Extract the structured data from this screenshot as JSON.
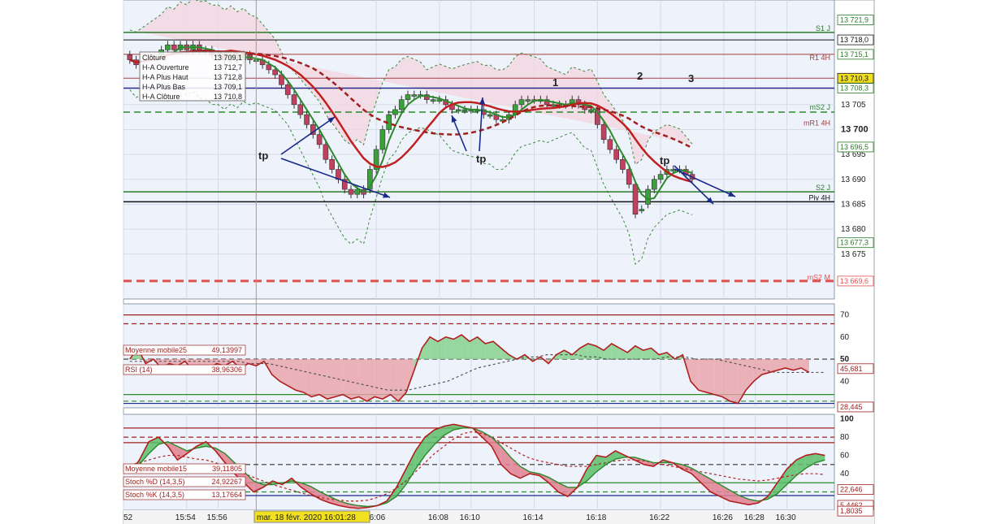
{
  "chart_data": [
    {
      "type": "candlestick",
      "panel": "price",
      "ylim": [
        13666,
        13726
      ],
      "y_ticks": [
        13675,
        13680,
        13685,
        13690,
        13695,
        13700,
        13705
      ],
      "y_tick_labels": [
        "13 675",
        "13 680",
        "13 685",
        "13 690",
        "13 695",
        "13 700",
        "13 705"
      ],
      "x_tick_labels": [
        "52",
        "15:54",
        "15:56",
        "16:06",
        "16:08",
        "16:10",
        "16:14",
        "16:18",
        "16:22",
        "16:26",
        "16:28",
        "16:30"
      ],
      "x_tick_positions": [
        0,
        2,
        3,
        8,
        10,
        11,
        13,
        15,
        17,
        19,
        20,
        21
      ],
      "x_range": [
        0,
        22.5
      ],
      "legend": [
        {
          "label": "Clôture",
          "value": "13 709,1"
        },
        {
          "label": "H-A Ouverture",
          "value": "13 712,7"
        },
        {
          "label": "H-A Plus Haut",
          "value": "13 712,8"
        },
        {
          "label": "H-A Plus Bas",
          "value": "13 709,1"
        },
        {
          "label": "H-A Clôture",
          "value": "13 710,8"
        }
      ],
      "candles_t": [
        0.2,
        0.4,
        1.2,
        1.4,
        1.6,
        1.8,
        2.0,
        2.2,
        2.4,
        2.6,
        2.8,
        3.0,
        3.2,
        3.4,
        3.6,
        3.8,
        4.0,
        4.2,
        4.4,
        4.6,
        4.8,
        5.0,
        5.2,
        5.4,
        5.6,
        5.8,
        6.0,
        6.2,
        6.4,
        6.6,
        6.8,
        7.0,
        7.2,
        7.4,
        7.6,
        7.8,
        8.0,
        8.2,
        8.4,
        8.6,
        8.8,
        9.0,
        9.2,
        9.4,
        9.6,
        9.8,
        10.0,
        10.2,
        10.4,
        10.6,
        10.8,
        11.0,
        11.2,
        11.4,
        11.6,
        11.8,
        12.0,
        12.2,
        12.4,
        12.6,
        12.8,
        13.0,
        13.2,
        13.4,
        13.6,
        13.8,
        14.0,
        14.2,
        14.4,
        14.6,
        14.8,
        15.0,
        15.2,
        15.4,
        15.6,
        15.8,
        16.0,
        16.2,
        16.4,
        16.6,
        16.8,
        17.0,
        17.2,
        17.4,
        17.6,
        17.8,
        18.0,
        18.2,
        18.4,
        18.6,
        18.8,
        19.0,
        19.2,
        19.4,
        19.6,
        19.8,
        20.0,
        20.2,
        20.4,
        20.6,
        20.8,
        21.0,
        21.2,
        21.4,
        21.6,
        21.8,
        22.0,
        22.2
      ],
      "candles_c": [
        13714,
        13713,
        13716,
        13717,
        13716,
        13717,
        13716,
        13717,
        13716,
        13716,
        13715,
        13715,
        13714,
        13715,
        13714,
        13715,
        13714,
        13714,
        13713,
        13712,
        13711,
        13709,
        13707,
        13705,
        13703,
        13701,
        13699,
        13697,
        13694,
        13692,
        13690,
        13688,
        13687,
        13688,
        13687,
        13692,
        13696,
        13700,
        13703,
        13704,
        13706,
        13707,
        13707,
        13707,
        13706,
        13706,
        13706,
        13705,
        13704,
        13704,
        13704,
        13704,
        13704,
        13703,
        13703,
        13702,
        13702,
        13703,
        13705,
        13706,
        13706,
        13706,
        13706,
        13705,
        13705,
        13705,
        13705,
        13706,
        13705,
        13704,
        13704,
        13701,
        13698,
        13696,
        13694,
        13692,
        13689,
        13683,
        13684,
        13688,
        13690,
        13691,
        13692,
        13692,
        13692,
        13691,
        13690
      ],
      "candles_o": [
        13715,
        13714,
        13715,
        13716,
        13717,
        13716,
        13717,
        13716,
        13717,
        13716,
        13716,
        13715,
        13715,
        13714,
        13715,
        13714,
        13715,
        13714,
        13714,
        13713,
        13712,
        13711,
        13709,
        13707,
        13705,
        13703,
        13701,
        13699,
        13697,
        13694,
        13692,
        13690,
        13688,
        13687,
        13688,
        13688,
        13692,
        13696,
        13700,
        13703,
        13704,
        13706,
        13707,
        13707,
        13707,
        13706,
        13706,
        13706,
        13705,
        13704,
        13704,
        13704,
        13704,
        13704,
        13703,
        13703,
        13702,
        13702,
        13703,
        13705,
        13706,
        13706,
        13706,
        13706,
        13705,
        13705,
        13705,
        13705,
        13706,
        13705,
        13704,
        13704,
        13701,
        13698,
        13696,
        13694,
        13692,
        13689,
        13684,
        13685,
        13688,
        13690,
        13691,
        13692,
        13692,
        13692,
        13691
      ],
      "support_resistance_labels": [
        "S1 J",
        "R1 4H",
        "mS2 J",
        "mR1 4H",
        "S2 J",
        "Piv 4H",
        "mS2 M"
      ],
      "price_labels": [
        "13 721,9",
        "13 718,0",
        "13 715,1",
        "13 710,3",
        "13 708,3",
        "13 696,5",
        "13 677,3",
        "13 669,6"
      ],
      "annotations": [
        "1",
        "2",
        "3",
        "tp",
        "tp",
        "tp"
      ],
      "cursor_label": "mar. 18 févr. 2020 16:01:28"
    },
    {
      "type": "line",
      "panel": "rsi",
      "ylim": [
        28,
        75
      ],
      "y_ticks": [
        40,
        50,
        60,
        70
      ],
      "legend": [
        {
          "label": "Moyenne mobile25",
          "value": "49,13997"
        },
        {
          "label": "RSI (14)",
          "value": "38,96306"
        }
      ],
      "price_labels": [
        "45,681",
        "28,445"
      ],
      "series": [
        {
          "name": "RSI (14)",
          "values": [
            50,
            55,
            48,
            50,
            46,
            48,
            47,
            49,
            45,
            47,
            46,
            48,
            47,
            49,
            46,
            48,
            47,
            49,
            43,
            40,
            38,
            36,
            35,
            33,
            34,
            32,
            33,
            34,
            32,
            33,
            31,
            33,
            32,
            34,
            31,
            35,
            45,
            55,
            60,
            58,
            60,
            59,
            61,
            58,
            60,
            57,
            58,
            55,
            52,
            50,
            52,
            49,
            51,
            48,
            52,
            54,
            52,
            55,
            57,
            56,
            54,
            57,
            55,
            53,
            56,
            54,
            55,
            52,
            53,
            50,
            52,
            40,
            36,
            35,
            34,
            33,
            31,
            30,
            36,
            40,
            43,
            44,
            45,
            46,
            45,
            46,
            44
          ]
        },
        {
          "name": "Moyenne mobile25",
          "values": [
            49,
            49,
            49,
            49,
            49,
            49,
            49,
            49,
            49,
            49,
            49,
            49,
            48,
            48,
            48,
            47,
            46,
            45,
            44,
            43,
            42,
            41,
            40,
            39,
            38,
            37,
            36,
            36,
            36,
            37,
            38,
            39,
            40,
            42,
            44,
            46,
            47,
            48,
            49,
            50,
            51,
            51,
            52,
            52,
            52,
            52,
            51,
            51,
            50,
            50,
            50,
            50,
            50,
            50,
            51,
            51,
            51,
            50,
            50,
            50,
            49,
            48,
            47,
            46,
            45,
            44,
            44,
            44,
            44,
            44,
            44
          ]
        }
      ]
    },
    {
      "type": "line",
      "panel": "stochastic",
      "ylim": [
        0,
        105
      ],
      "y_ticks": [
        20,
        40,
        60,
        80,
        100
      ],
      "legend": [
        {
          "label": "Moyenne mobile15",
          "value": "39,11805"
        },
        {
          "label": "Stoch %D (14,3,5)",
          "value": "24,92267"
        },
        {
          "label": "Stoch %K (14,3,5)",
          "value": "13,17664"
        }
      ],
      "price_labels": [
        "22,646",
        "5,4462",
        "1,8035"
      ],
      "series": [
        {
          "name": "Stoch %K (14,3,5)",
          "values": [
            40,
            55,
            75,
            80,
            70,
            55,
            62,
            70,
            75,
            65,
            52,
            40,
            30,
            20,
            25,
            32,
            28,
            35,
            25,
            18,
            12,
            8,
            5,
            3,
            2,
            3,
            5,
            10,
            25,
            45,
            65,
            80,
            88,
            92,
            94,
            92,
            90,
            80,
            70,
            50,
            40,
            35,
            40,
            38,
            30,
            20,
            15,
            25,
            45,
            60,
            58,
            65,
            60,
            55,
            50,
            48,
            55,
            52,
            45,
            40,
            30,
            20,
            15,
            10,
            8,
            6,
            8,
            15,
            30,
            45,
            55,
            60,
            62,
            60
          ]
        },
        {
          "name": "Stoch %D (14,3,5)",
          "values": [
            42,
            50,
            62,
            72,
            75,
            70,
            65,
            68,
            70,
            68,
            62,
            52,
            42,
            32,
            28,
            28,
            30,
            32,
            30,
            26,
            20,
            15,
            10,
            7,
            5,
            4,
            5,
            8,
            15,
            28,
            45,
            60,
            72,
            82,
            88,
            90,
            90,
            86,
            80,
            70,
            58,
            48,
            42,
            40,
            36,
            30,
            25,
            25,
            32,
            42,
            50,
            56,
            58,
            58,
            55,
            52,
            52,
            52,
            50,
            46,
            40,
            34,
            28,
            22,
            16,
            12,
            10,
            12,
            18,
            28,
            38,
            46,
            52,
            55
          ]
        },
        {
          "name": "Moyenne mobile15",
          "values": [
            50,
            52,
            55,
            58,
            60,
            60,
            58,
            56,
            55,
            52,
            48,
            44,
            40,
            36,
            32,
            28,
            25,
            22,
            19,
            16,
            14,
            12,
            11,
            10,
            10,
            11,
            14,
            18,
            24,
            32,
            42,
            52,
            62,
            70,
            78,
            84,
            86,
            84,
            80,
            74,
            68,
            62,
            57,
            54,
            52,
            50,
            48,
            48,
            48,
            50,
            52,
            54,
            55,
            55,
            54,
            52,
            50,
            48,
            46,
            44,
            42,
            40,
            38,
            36,
            34,
            33,
            32,
            33,
            35,
            37,
            39,
            40,
            40,
            39
          ]
        }
      ]
    }
  ]
}
